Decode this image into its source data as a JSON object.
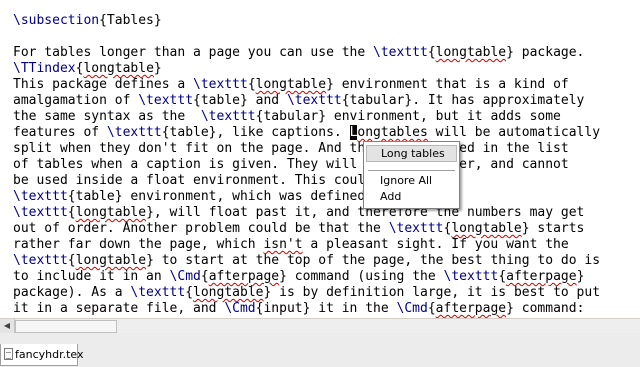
{
  "editor": {
    "lines": [
      [
        {
          "t": "\\subsection",
          "c": 1
        },
        {
          "t": "{Tables}"
        }
      ],
      [],
      [
        {
          "t": "For tables longer than a page you can use the "
        },
        {
          "t": "\\texttt",
          "c": 1
        },
        {
          "t": "{"
        },
        {
          "t": "longtable",
          "s": 1
        },
        {
          "t": "} package."
        }
      ],
      [
        {
          "t": "\\TTindex",
          "c": 1
        },
        {
          "t": "{"
        },
        {
          "t": "longtable",
          "s": 1
        },
        {
          "t": "}"
        }
      ],
      [
        {
          "t": "This package defines a "
        },
        {
          "t": "\\texttt",
          "c": 1
        },
        {
          "t": "{"
        },
        {
          "t": "longtable",
          "s": 1
        },
        {
          "t": "} environment that is a kind of"
        }
      ],
      [
        {
          "t": "amalgamation of "
        },
        {
          "t": "\\texttt",
          "c": 1
        },
        {
          "t": "{table} and "
        },
        {
          "t": "\\texttt",
          "c": 1
        },
        {
          "t": "{tabular}. It has approximately"
        }
      ],
      [
        {
          "t": "the same syntax as the  "
        },
        {
          "t": "\\texttt",
          "c": 1
        },
        {
          "t": "{tabular} environment, but it adds some"
        }
      ],
      [
        {
          "t": "features of "
        },
        {
          "t": "\\texttt",
          "c": 1
        },
        {
          "t": "{table}, like captions. "
        },
        {
          "t": "L",
          "k": 1
        },
        {
          "t": "ongtables",
          "s": 1
        },
        {
          "t": " will be automatically"
        }
      ],
      [
        {
          "t": "split when they don't fit on the page. And they are entered in the list"
        }
      ],
      [
        {
          "t": "of tables when a caption is given. They will float, however, and cannot"
        }
      ],
      [
        {
          "t": "be used inside a float environment. This could be another"
        }
      ],
      [
        {
          "t": "\\texttt",
          "c": 1
        },
        {
          "t": "{table} environment, which was defined"
        }
      ],
      [
        {
          "t": "\\texttt",
          "c": 1
        },
        {
          "t": "{"
        },
        {
          "t": "longtable",
          "s": 1
        },
        {
          "t": "}, will float past it, and therefore the numbers may get"
        }
      ],
      [
        {
          "t": "out of order. Another problem could be that the "
        },
        {
          "t": "\\texttt",
          "c": 1
        },
        {
          "t": "{"
        },
        {
          "t": "longtable",
          "s": 1
        },
        {
          "t": "} starts"
        }
      ],
      [
        {
          "t": "rather far down the page, which "
        },
        {
          "t": "isn't",
          "s": 1
        },
        {
          "t": " a pleasant sight. If you want the"
        }
      ],
      [
        {
          "t": "\\texttt",
          "c": 1
        },
        {
          "t": "{"
        },
        {
          "t": "longtable",
          "s": 1
        },
        {
          "t": "} to start at the top of the page, the best thing to do is"
        }
      ],
      [
        {
          "t": "to include it in an "
        },
        {
          "t": "\\Cmd",
          "c": 1
        },
        {
          "t": "{"
        },
        {
          "t": "afterpage",
          "s": 1
        },
        {
          "t": "} command (using the "
        },
        {
          "t": "\\texttt",
          "c": 1
        },
        {
          "t": "{"
        },
        {
          "t": "afterpage",
          "s": 1
        },
        {
          "t": "}"
        }
      ],
      [
        {
          "t": "package). As a "
        },
        {
          "t": "\\texttt",
          "c": 1
        },
        {
          "t": "{"
        },
        {
          "t": "longtable",
          "s": 1
        },
        {
          "t": "} is by definition large, it is best to put"
        }
      ],
      [
        {
          "t": "it in a separate file, and "
        },
        {
          "t": "\\Cmd",
          "c": 1
        },
        {
          "t": "{input} it in the "
        },
        {
          "t": "\\Cmd",
          "c": 1
        },
        {
          "t": "{"
        },
        {
          "t": "afterpage",
          "s": 1
        },
        {
          "t": "} command:"
        }
      ]
    ]
  },
  "context_menu": {
    "suggestion": "Long tables",
    "ignore_all": "Ignore All",
    "add": "Add"
  },
  "scrollbar": {
    "left_arrow_icon": "arrow-left-icon"
  },
  "tabs": [
    {
      "label": "fancyhdr.tex",
      "icon": "document-icon"
    }
  ]
}
